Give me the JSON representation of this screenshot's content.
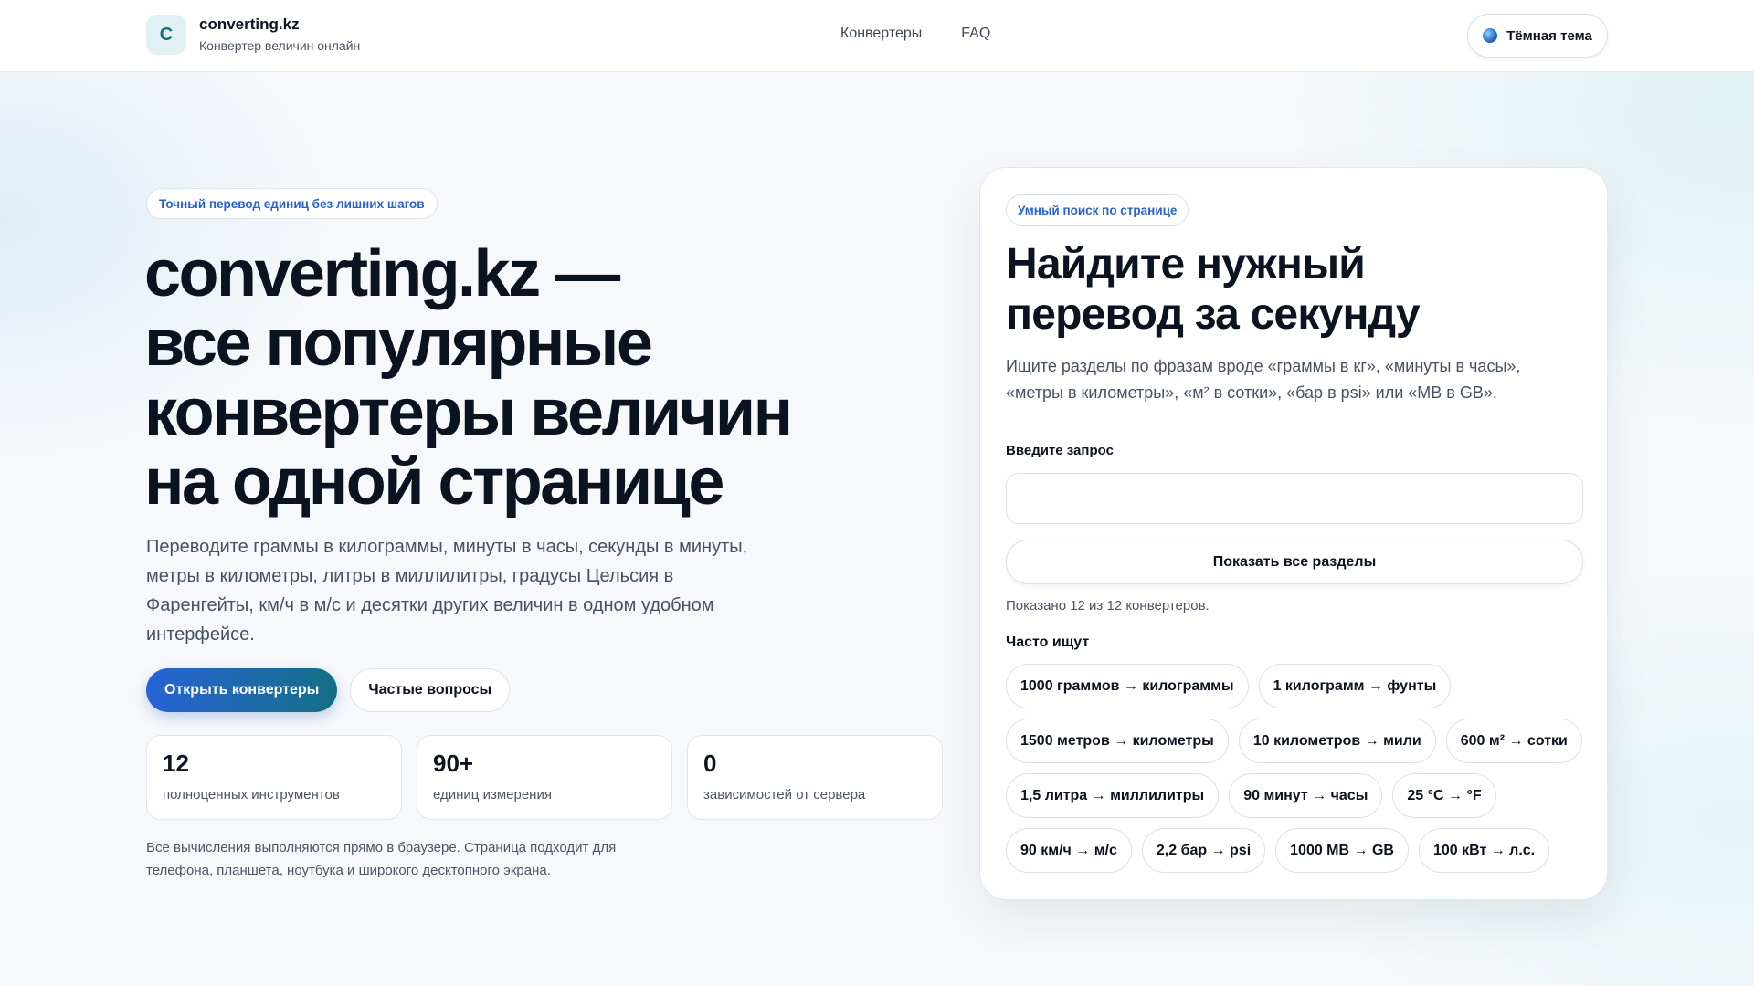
{
  "header": {
    "logo_letter": "C",
    "brand_name": "converting.kz",
    "brand_subtitle": "Конвертер величин онлайн",
    "nav": [
      {
        "label": "Конвертеры"
      },
      {
        "label": "FAQ"
      }
    ],
    "theme_toggle_label": "Тёмная тема",
    "theme_icon": "globe-icon"
  },
  "hero": {
    "badge": "Точный перевод единиц без лишних шагов",
    "title_lines": [
      "converting.kz —",
      "все популярные",
      "конвертеры величин",
      "на одной странице"
    ],
    "description": "Переводите граммы в килограммы, минуты в часы, секунды в минуты, метры в километры, литры в миллилитры, градусы Цельсия в Фаренгейты, км/ч в м/с и десятки других величин в одном удобном интерфейсе.",
    "primary_button": "Открыть конвертеры",
    "secondary_button": "Частые вопросы",
    "stats": [
      {
        "value": "12",
        "label": "полноценных инструментов"
      },
      {
        "value": "90+",
        "label": "единиц измерения"
      },
      {
        "value": "0",
        "label": "зависимостей от сервера"
      }
    ],
    "footnote": "Все вычисления выполняются прямо в браузере. Страница подходит для телефона, планшета, ноутбука и широкого десктопного экрана."
  },
  "search": {
    "badge": "Умный поиск по странице",
    "title": "Найдите нужный перевод за секунду",
    "description": "Ищите разделы по фразам вроде «граммы в кг», «минуты в часы», «метры в километры», «м² в сотки», «бар в psi» или «MB в GB».",
    "input_label": "Введите запрос",
    "input_value": "",
    "show_all_button": "Показать все разделы",
    "count_text": "Показано 12 из 12 конвертеров.",
    "frequent_label": "Часто ищут",
    "chips": [
      "1000 граммов → килограммы",
      "1 килограмм → фунты",
      "1500 метров → километры",
      "10 километров → мили",
      "600 м² → сотки",
      "1,5 литра → миллилитры",
      "90 минут → часы",
      "25 °C → °F",
      "90 км/ч → м/с",
      "2,2 бар → psi",
      "1000 MB → GB",
      "100 кВт → л.с."
    ]
  },
  "colors": {
    "accent_blue": "#2763d6",
    "accent_teal": "#146f86",
    "badge_text": "#2a62c9",
    "text_dark": "#0b1220",
    "text_muted": "#465264"
  }
}
